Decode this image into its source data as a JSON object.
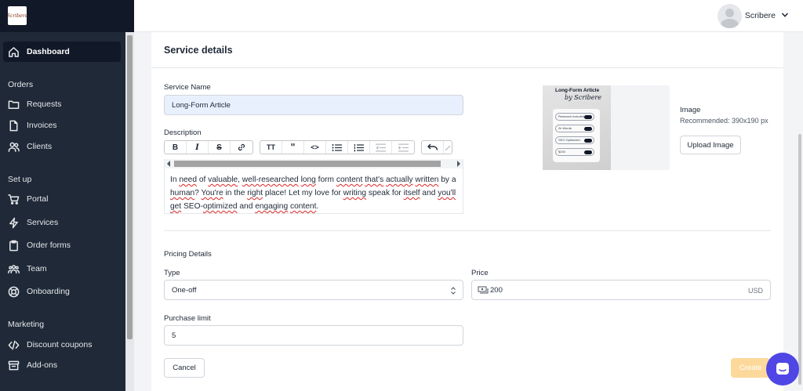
{
  "sidebar": {
    "logo_text": "Scribere",
    "dashboard": "Dashboard",
    "sections": {
      "orders": "Orders",
      "setup": "Set up",
      "marketing": "Marketing"
    },
    "items": {
      "requests": "Requests",
      "invoices": "Invoices",
      "clients": "Clients",
      "portal": "Portal",
      "services": "Services",
      "order_forms": "Order forms",
      "team": "Team",
      "onboarding": "Onboarding",
      "discount_coupons": "Discount coupons",
      "add_ons": "Add-ons"
    }
  },
  "topbar": {
    "username": "Scribere"
  },
  "form": {
    "title": "Service details",
    "service_name_label": "Service Name",
    "service_name_value": "Long-Form Article",
    "description_label": "Description",
    "description_segments": [
      "In ",
      "need",
      " of ",
      "valuable",
      ", ",
      "well-researched",
      " ",
      "long",
      " form ",
      "content",
      " ",
      "that's",
      " ",
      "actually",
      " ",
      "written",
      " by a ",
      "human",
      "? ",
      "You're",
      " in the ",
      "right",
      " place! Let my love for ",
      "writing",
      " speak for ",
      "itself",
      " and ",
      "you'll",
      " ",
      "get",
      " SEO-",
      "optimized",
      " and ",
      "engaging",
      " ",
      "content",
      "."
    ],
    "image_label": "Image",
    "image_recommended": "Recommended: 390x190 px",
    "upload_button": "Upload Image",
    "thumbnail": {
      "title": "Long-Form Article",
      "subtitle": "by Scribere",
      "pills": [
        "Research included",
        "2k Words",
        "SEO Optimized",
        "$200"
      ]
    },
    "pricing_title": "Pricing Details",
    "type_label": "Type",
    "type_value": "One-off",
    "price_label": "Price",
    "price_value": "200",
    "price_currency": "USD",
    "purchase_limit_label": "Purchase limit",
    "purchase_limit_value": "5",
    "cancel_button": "Cancel",
    "create_button": "Create"
  }
}
